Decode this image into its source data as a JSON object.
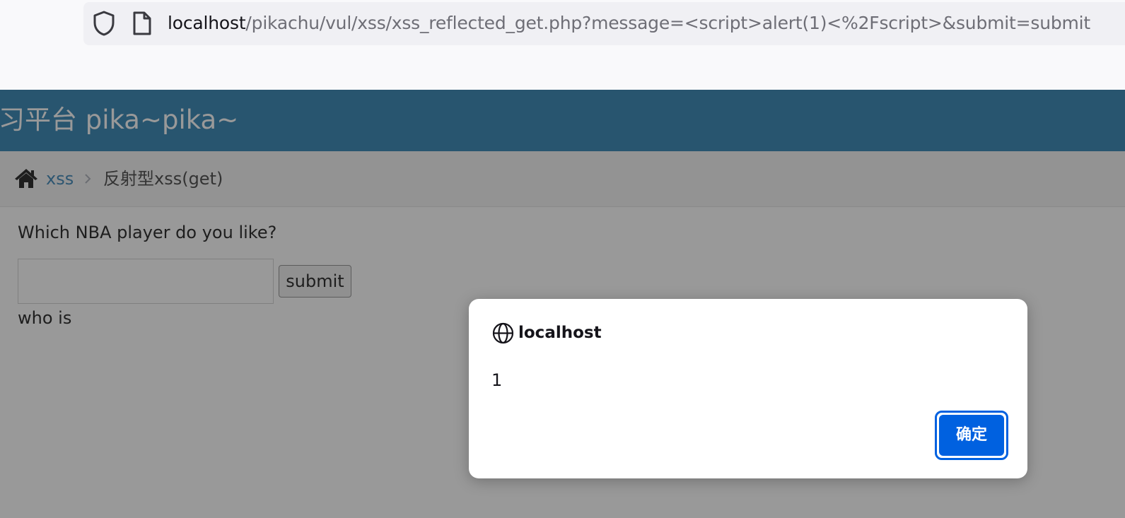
{
  "browser": {
    "url_host": "localhost",
    "url_path": "/pikachu/vul/xss/xss_reflected_get.php?message=<script>alert(1)<%2Fscript>&submit=submit"
  },
  "page": {
    "brand": "习平台 pika~pika~",
    "breadcrumb": {
      "section": "xss",
      "current": "反射型xss(get)"
    },
    "question": "Which NBA player do you like?",
    "message_input": {
      "value": "",
      "placeholder": ""
    },
    "submit_label": "submit",
    "result_text": "who is"
  },
  "dialog": {
    "origin": "localhost",
    "message": "1",
    "ok_label": "确定"
  },
  "colors": {
    "header_bg": "#438eb9",
    "accent": "#0061e0",
    "link": "#4c8fbd"
  }
}
